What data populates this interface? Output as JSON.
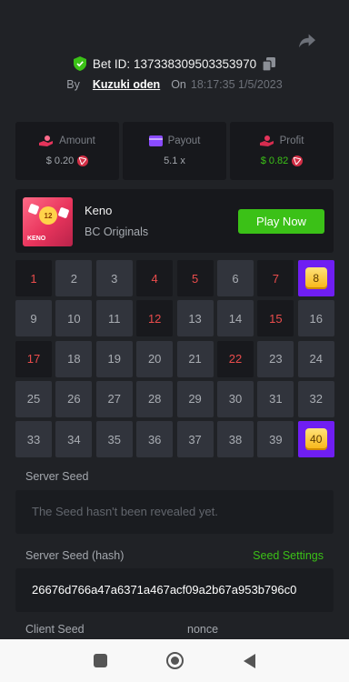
{
  "bet": {
    "id_label": "Bet ID:",
    "id": "137338309503353970",
    "by_label": "By",
    "user": "Kuzuki oden",
    "on_label": "On",
    "time": "18:17:35 1/5/2023"
  },
  "stats": {
    "amount": {
      "label": "Amount",
      "value": "$ 0.20"
    },
    "payout": {
      "label": "Payout",
      "value": "5.1 x"
    },
    "profit": {
      "label": "Profit",
      "value": "$ 0.82"
    }
  },
  "game": {
    "thumb_number": "12",
    "thumb_label": "KENO",
    "name": "Keno",
    "provider": "BC Originals",
    "play_label": "Play Now"
  },
  "grid": [
    {
      "n": "1",
      "state": "miss"
    },
    {
      "n": "2",
      "state": "normal"
    },
    {
      "n": "3",
      "state": "normal"
    },
    {
      "n": "4",
      "state": "miss"
    },
    {
      "n": "5",
      "state": "miss"
    },
    {
      "n": "6",
      "state": "normal"
    },
    {
      "n": "7",
      "state": "miss"
    },
    {
      "n": "8",
      "state": "hit"
    },
    {
      "n": "9",
      "state": "normal"
    },
    {
      "n": "10",
      "state": "normal"
    },
    {
      "n": "11",
      "state": "normal"
    },
    {
      "n": "12",
      "state": "miss"
    },
    {
      "n": "13",
      "state": "normal"
    },
    {
      "n": "14",
      "state": "normal"
    },
    {
      "n": "15",
      "state": "miss"
    },
    {
      "n": "16",
      "state": "normal"
    },
    {
      "n": "17",
      "state": "miss"
    },
    {
      "n": "18",
      "state": "normal"
    },
    {
      "n": "19",
      "state": "normal"
    },
    {
      "n": "20",
      "state": "normal"
    },
    {
      "n": "21",
      "state": "normal"
    },
    {
      "n": "22",
      "state": "miss"
    },
    {
      "n": "23",
      "state": "normal"
    },
    {
      "n": "24",
      "state": "normal"
    },
    {
      "n": "25",
      "state": "normal"
    },
    {
      "n": "26",
      "state": "normal"
    },
    {
      "n": "27",
      "state": "normal"
    },
    {
      "n": "28",
      "state": "normal"
    },
    {
      "n": "29",
      "state": "normal"
    },
    {
      "n": "30",
      "state": "normal"
    },
    {
      "n": "31",
      "state": "normal"
    },
    {
      "n": "32",
      "state": "normal"
    },
    {
      "n": "33",
      "state": "normal"
    },
    {
      "n": "34",
      "state": "normal"
    },
    {
      "n": "35",
      "state": "normal"
    },
    {
      "n": "36",
      "state": "normal"
    },
    {
      "n": "37",
      "state": "normal"
    },
    {
      "n": "38",
      "state": "normal"
    },
    {
      "n": "39",
      "state": "normal"
    },
    {
      "n": "40",
      "state": "hit"
    }
  ],
  "server_seed": {
    "label": "Server Seed",
    "message": "The Seed hasn't been revealed yet."
  },
  "server_hash": {
    "label": "Server Seed (hash)",
    "settings_label": "Seed Settings",
    "value": "26676d766a47a6371a467acf09a2b67a953b796c0"
  },
  "client": {
    "label": "Client Seed",
    "nonce_label": "nonce"
  },
  "colors": {
    "accent_green": "#3bc117",
    "hit_purple": "#6f1ef2",
    "miss_red": "#ea4c4c",
    "background": "#202226"
  },
  "icons": {
    "share": "share-icon",
    "shield": "shield-check-icon",
    "copy": "copy-icon",
    "amount": "coins-hand-icon",
    "payout": "card-icon",
    "profit": "profit-hand-icon",
    "tron": "tron-coin-icon"
  }
}
